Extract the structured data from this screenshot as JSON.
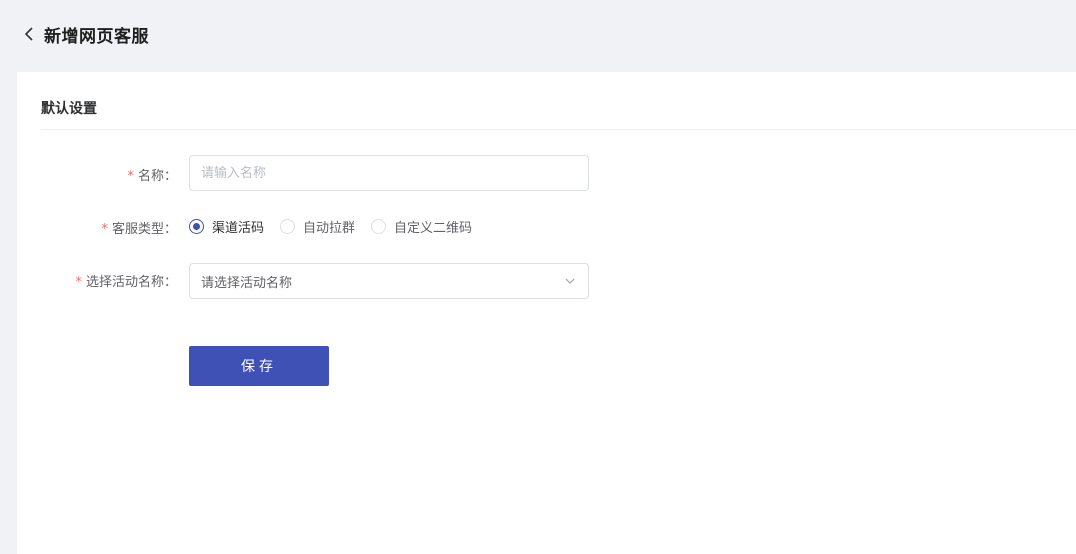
{
  "header": {
    "title": "新增网页客服",
    "back_icon": "chevron-left-icon"
  },
  "section": {
    "title": "默认设置"
  },
  "form": {
    "name": {
      "label": "名称：",
      "required_mark": "*",
      "value": "",
      "placeholder": "请输入名称"
    },
    "service_type": {
      "label": "客服类型：",
      "required_mark": "*",
      "options": [
        {
          "label": "渠道活码",
          "checked": true
        },
        {
          "label": "自动拉群",
          "checked": false
        },
        {
          "label": "自定义二维码",
          "checked": false
        }
      ]
    },
    "activity": {
      "label": "选择活动名称：",
      "required_mark": "*",
      "placeholder": "请选择活动名称",
      "icon": "chevron-down-icon"
    }
  },
  "actions": {
    "save_label": "保存"
  },
  "colors": {
    "primary": "#3f51b5",
    "required": "#f56c6c",
    "background": "#f0f2f5",
    "card": "#ffffff"
  }
}
